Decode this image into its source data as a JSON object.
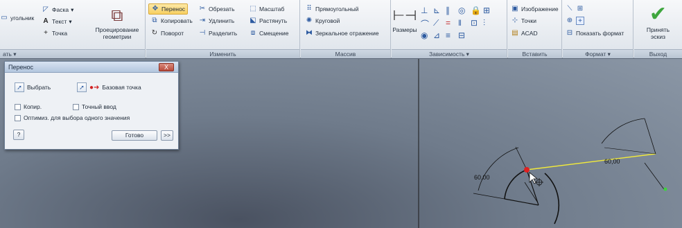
{
  "ribbon": {
    "sketch_panel": {
      "rect_partial": "угольник",
      "chamfer": "Фаска",
      "text": "Текст",
      "point": "Точка",
      "projection": "Проецирование геометрии",
      "title_partial": "ать"
    },
    "modify_panel": {
      "title": "Изменить",
      "move": "Перенос",
      "copy": "Копировать",
      "rotate": "Поворот",
      "trim": "Обрезать",
      "extend": "Удлинить",
      "split": "Разделить",
      "scale": "Масштаб",
      "stretch": "Растянуть",
      "offset": "Смещение"
    },
    "pattern_panel": {
      "title": "Массив",
      "rect": "Прямоугольный",
      "circular": "Круговой",
      "mirror": "Зеркальное отражение"
    },
    "constrain_panel": {
      "title": "Зависимость",
      "dimensions": "Размеры"
    },
    "insert_panel": {
      "title": "Вставить",
      "image": "Изображение",
      "points": "Точки",
      "acad": "ACAD"
    },
    "format_panel": {
      "title": "Формат",
      "show_format": "Показать формат"
    },
    "exit_panel": {
      "title": "Выход",
      "accept": "Принять эскиз"
    }
  },
  "dialog": {
    "title": "Перенос",
    "close": "X",
    "select": "Выбрать",
    "base_point": "Базовая точка",
    "copy": "Копир.",
    "precise": "Точный ввод",
    "optimize": "Оптимиз. для выбора одного значения",
    "help": "?",
    "done": "Готово",
    "more": ">>"
  },
  "viewport": {
    "dim_left": "60,00",
    "dim_right": "60,00"
  },
  "colors": {
    "selection_red": "#e02020",
    "move_line_yellow": "#f2ea3a",
    "green_point": "#3fd23f"
  }
}
